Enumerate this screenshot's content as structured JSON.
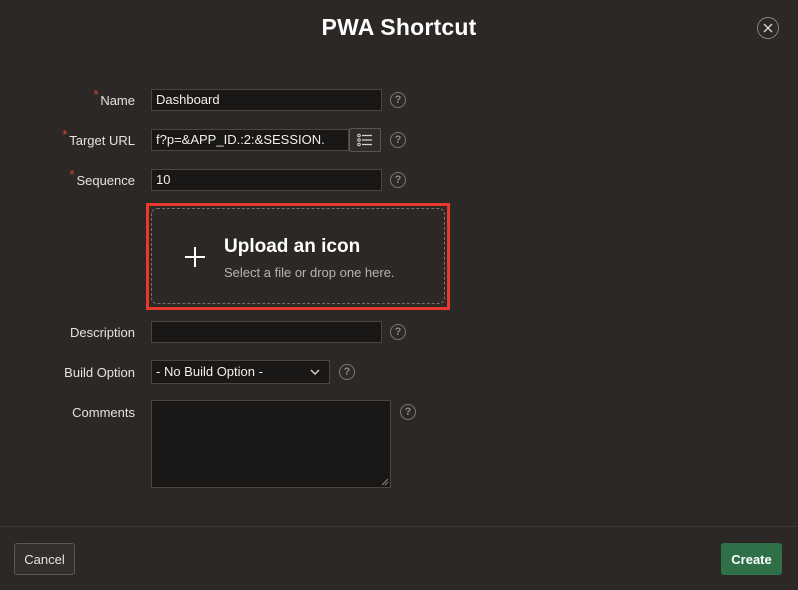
{
  "dialog": {
    "title": "PWA Shortcut",
    "close_icon": "close-icon"
  },
  "form": {
    "required_marker": "*",
    "help_glyph": "?",
    "name": {
      "label": "Name",
      "value": "Dashboard",
      "required": true
    },
    "target_url": {
      "label": "Target URL",
      "value": "f?p=&APP_ID.:2:&SESSION.",
      "required": true,
      "lov_icon": "list-icon"
    },
    "sequence": {
      "label": "Sequence",
      "value": "10",
      "required": true
    },
    "upload": {
      "title": "Upload an icon",
      "subtitle": "Select a file or drop one here.",
      "icon": "plus-icon",
      "highlight_color": "#e8392c"
    },
    "description": {
      "label": "Description",
      "value": ""
    },
    "build_option": {
      "label": "Build Option",
      "selected": "- No Build Option -"
    },
    "comments": {
      "label": "Comments",
      "value": ""
    }
  },
  "footer": {
    "cancel_label": "Cancel",
    "create_label": "Create",
    "create_color": "#2f7048"
  }
}
